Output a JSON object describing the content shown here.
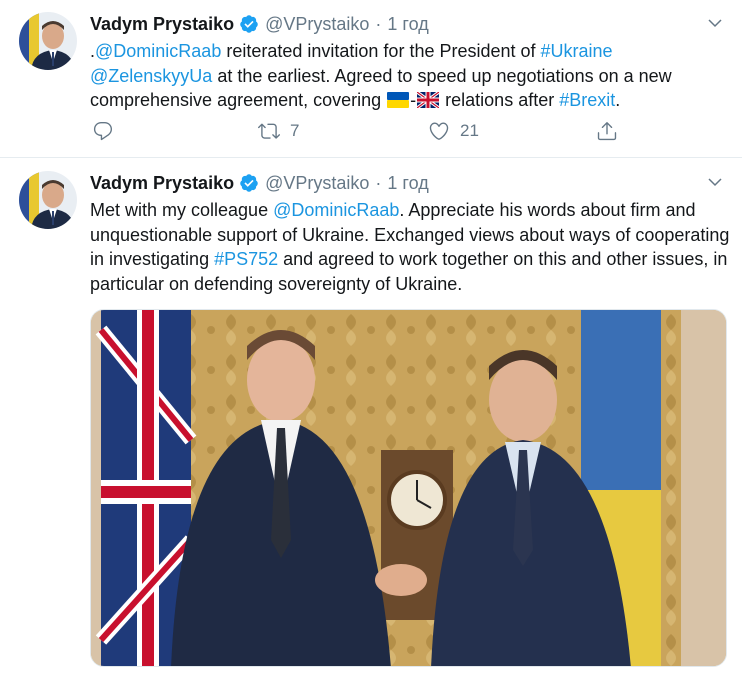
{
  "tweets": [
    {
      "author_name": "Vadym Prystaiko",
      "handle": "@VPrystaiko",
      "separator": "·",
      "time": "1 год",
      "text_parts": [
        ".",
        "@DominicRaab",
        " reiterated invitation for the President of ",
        "#Ukraine",
        "@ZelenskyyUa",
        " at the earliest. Agreed to speed up negotiations on a new comprehensive agreement, covering ",
        "-",
        " relations after ",
        "#Brexit",
        "."
      ],
      "flags": [
        "ukraine-flag-icon",
        "uk-flag-icon"
      ],
      "actions": {
        "reply_count": "",
        "retweet_count": "7",
        "like_count": "21"
      }
    },
    {
      "author_name": "Vadym Prystaiko",
      "handle": "@VPrystaiko",
      "separator": "·",
      "time": "1 год",
      "text_parts": [
        "Met with my colleague ",
        "@DominicRaab",
        ". Appreciate his words about firm and unquestionable support of Ukraine. Exchanged views about ways of cooperating in investigating ",
        "#PS752",
        "  and agreed to work together on this and other issues, in particular on defending sovereignty of Ukraine."
      ],
      "photo": "two men in suits shaking hands between UK and Ukraine flags"
    }
  ],
  "colors": {
    "link": "#1b95e0",
    "secondary_text": "#657786",
    "verified": "#1da1f2",
    "divider": "#e6ecf0"
  }
}
